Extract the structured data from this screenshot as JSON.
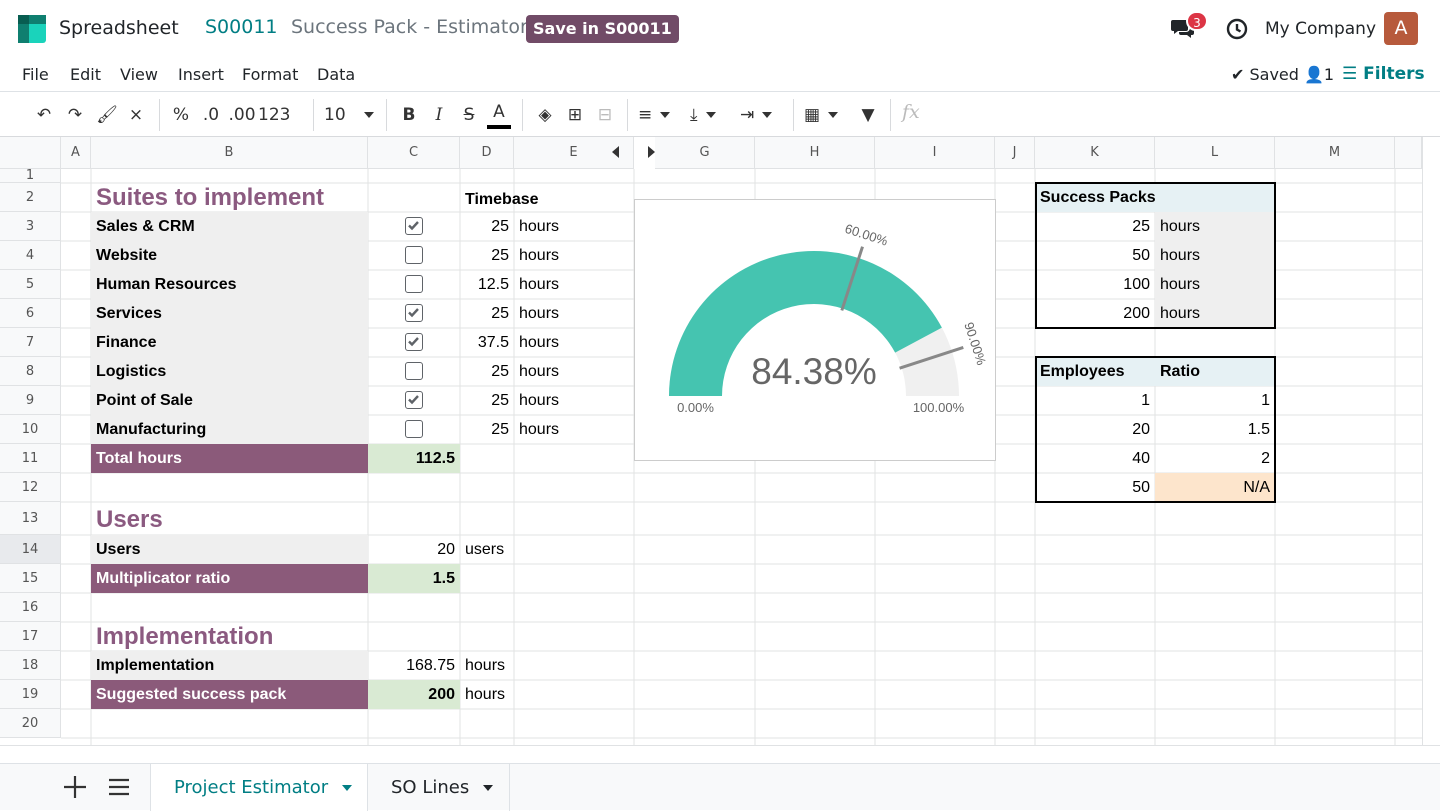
{
  "topbar": {
    "app_name": "Spreadsheet",
    "record": "S00011",
    "title": "Success Pack - Estimator",
    "save_label": "Save in S00011",
    "chat_count": "3",
    "company": "My Company",
    "avatar": "A",
    "colors": {
      "accent": "#017e84",
      "brand": "#714b67",
      "badge": "#dc3545"
    }
  },
  "menus": [
    "File",
    "Edit",
    "View",
    "Insert",
    "Format",
    "Data"
  ],
  "status": {
    "saved": "Saved",
    "users": "1",
    "filters": "Filters"
  },
  "toolbar": {
    "percent": "%",
    "dec_dec": ".0",
    "inc_dec": ".00",
    "format": "123",
    "font_size": "10",
    "bold": "B",
    "italic": "I",
    "strike": "S",
    "text_color": "A",
    "formula_placeholder": "fx",
    "icons": [
      "undo-icon",
      "redo-icon",
      "paint-format-icon",
      "clear-format-icon",
      "fill-color-icon",
      "borders-icon",
      "merge-icon",
      "align-icon",
      "valign-icon",
      "wrap-icon",
      "pivot-icon",
      "filter-icon"
    ]
  },
  "columns": [
    "A",
    "B",
    "C",
    "D",
    "E",
    "G",
    "H",
    "I",
    "J",
    "K",
    "L",
    "M"
  ],
  "rows": [
    "1",
    "2",
    "3",
    "4",
    "5",
    "6",
    "7",
    "8",
    "9",
    "10",
    "11",
    "12",
    "13",
    "14",
    "15",
    "16",
    "17",
    "18",
    "19",
    "20"
  ],
  "sheet": {
    "suites_title": "Suites to implement",
    "timebase": "Timebase",
    "suites": [
      {
        "name": "Sales & CRM",
        "checked": true,
        "hours": "25",
        "unit": "hours"
      },
      {
        "name": "Website",
        "checked": false,
        "hours": "25",
        "unit": "hours"
      },
      {
        "name": "Human Resources",
        "checked": false,
        "hours": "12.5",
        "unit": "hours"
      },
      {
        "name": "Services",
        "checked": true,
        "hours": "25",
        "unit": "hours"
      },
      {
        "name": "Finance",
        "checked": true,
        "hours": "37.5",
        "unit": "hours"
      },
      {
        "name": "Logistics",
        "checked": false,
        "hours": "25",
        "unit": "hours"
      },
      {
        "name": "Point of Sale",
        "checked": true,
        "hours": "25",
        "unit": "hours"
      },
      {
        "name": "Manufacturing",
        "checked": false,
        "hours": "25",
        "unit": "hours"
      }
    ],
    "total_label": "Total hours",
    "total_value": "112.5",
    "users_title": "Users",
    "users_label": "Users",
    "users_value": "20",
    "users_unit": "users",
    "ratio_label": "Multiplicator ratio",
    "ratio_value": "1.5",
    "impl_title": "Implementation",
    "impl_label": "Implementation",
    "impl_value": "168.75",
    "impl_unit": "hours",
    "suggested_label": "Suggested success pack",
    "suggested_value": "200",
    "suggested_unit": "hours",
    "packs_title": "Success Packs",
    "packs": [
      {
        "value": "25",
        "unit": "hours"
      },
      {
        "value": "50",
        "unit": "hours"
      },
      {
        "value": "100",
        "unit": "hours"
      },
      {
        "value": "200",
        "unit": "hours"
      }
    ],
    "employees_header": "Employees",
    "ratio_header": "Ratio",
    "employees": [
      {
        "employees": "1",
        "ratio": "1"
      },
      {
        "employees": "20",
        "ratio": "1.5"
      },
      {
        "employees": "40",
        "ratio": "2"
      },
      {
        "employees": "50",
        "ratio": "N/A"
      }
    ]
  },
  "chart_data": {
    "type": "gauge",
    "value": 84.38,
    "value_label": "84.38%",
    "min_label": "0.00%",
    "max_label": "100.00%",
    "min": 0,
    "max": 100,
    "inflection_points": [
      {
        "value": 60,
        "label": "60.00%"
      },
      {
        "value": 90,
        "label": "90.00%"
      }
    ],
    "fill_color": "#45c4b0",
    "background_color": "#f0f0f0"
  },
  "sheet_tabs": [
    {
      "label": "Project Estimator",
      "active": true
    },
    {
      "label": "SO Lines",
      "active": false
    }
  ]
}
